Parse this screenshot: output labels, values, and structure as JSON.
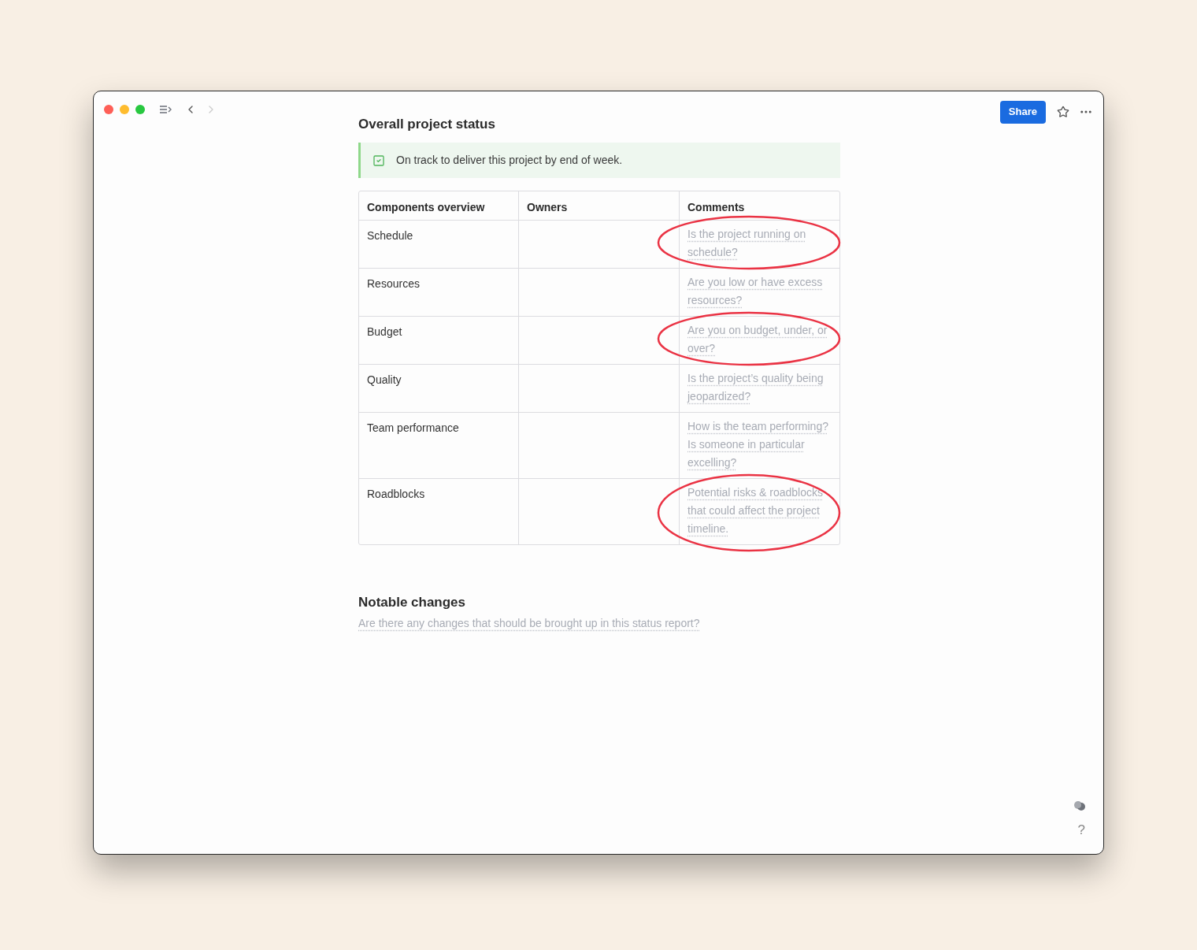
{
  "toolbar": {
    "share_label": "Share"
  },
  "status_section": {
    "title": "Overall project status",
    "callout": {
      "text": "On track to deliver this project by end of week.",
      "checked": true
    }
  },
  "table": {
    "columns": [
      "Components overview",
      "Owners",
      "Comments"
    ],
    "rows": [
      {
        "component": "Schedule",
        "comment": "Is the project running on schedule?",
        "circled": true
      },
      {
        "component": "Resources",
        "comment": "Are you low or have excess resources?",
        "circled": false
      },
      {
        "component": "Budget",
        "comment": "Are you on budget, under, or over?",
        "circled": true
      },
      {
        "component": "Quality",
        "comment": "Is the project’s quality being jeopardized?",
        "circled": false
      },
      {
        "component": "Team performance",
        "comment": "How is the team performing? Is someone in particular excelling?",
        "circled": false
      },
      {
        "component": "Roadblocks",
        "comment": "Potential risks & roadblocks that could affect the project timeline.",
        "circled": true
      }
    ]
  },
  "notable_changes": {
    "title": "Notable changes",
    "placeholder": "Are there any changes that should be brought up in this status report?"
  },
  "help": {
    "label": "?"
  }
}
